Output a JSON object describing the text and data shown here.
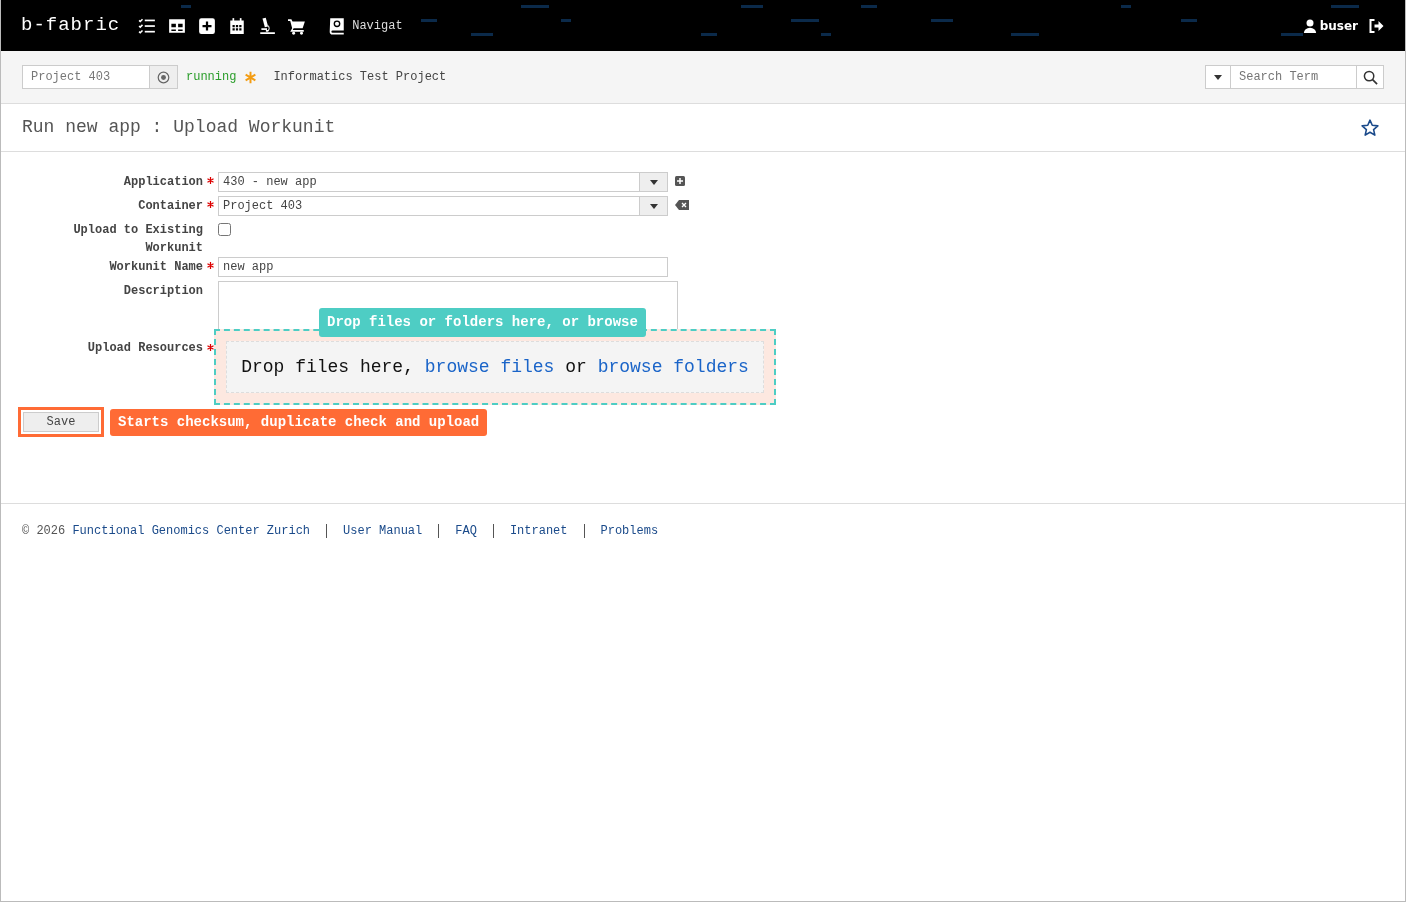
{
  "header": {
    "logo": "b-fabric",
    "nav_label": "Navigat",
    "user": "buser"
  },
  "project_bar": {
    "project_field": "Project 403",
    "status": "running",
    "project_name": "Informatics Test Project",
    "search": {
      "placeholder": "Search Term"
    }
  },
  "page_title": "Run new app : Upload Workunit",
  "form": {
    "fields": [
      {
        "kind": "select",
        "label": "Application",
        "required": true,
        "value": "430 - new app"
      },
      {
        "kind": "select",
        "label": "Container",
        "required": true,
        "value": "Project 403"
      },
      {
        "kind": "checkbox",
        "label": "Upload to Existing Workunit",
        "required": false,
        "checked": false
      },
      {
        "kind": "text",
        "label": "Workunit Name",
        "required": true,
        "value": "new app"
      },
      {
        "kind": "textarea",
        "label": "Description",
        "required": false
      },
      {
        "kind": "upload",
        "label": "Upload Resources",
        "required": true,
        "drop_text": "Drop files here,",
        "browse_files": "browse files",
        "or": "or",
        "browse_folders": "browse folders",
        "hint": "Drop files or folders here, or browse"
      }
    ],
    "save_button": "Save",
    "save_hint": "Starts checksum, duplicate check and upload"
  },
  "footer": {
    "copyright": "© 2026",
    "links": [
      "Functional Genomics Center Zurich",
      "User Manual",
      "FAQ",
      "Intranet",
      "Problems"
    ]
  }
}
